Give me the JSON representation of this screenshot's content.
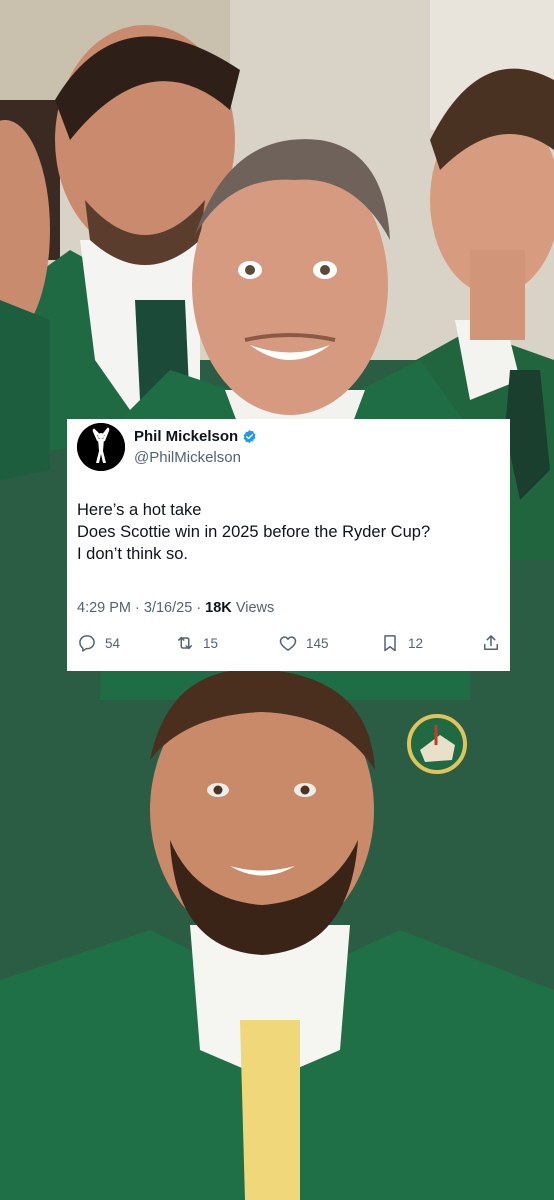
{
  "tweet": {
    "display_name": "Phil Mickelson",
    "handle": "@PhilMickelson",
    "verified": true,
    "avatar_icon": "golfer-silhouette-icon",
    "text_lines": [
      "Here’s a hot take",
      "Does Scottie win in 2025 before the Ryder Cup?",
      "I don’t think so."
    ],
    "time": "4:29 PM",
    "date": "3/16/25",
    "views_count": "18K",
    "views_label": "Views",
    "separator": "·",
    "actions": {
      "replies": {
        "icon": "reply-icon",
        "count": "54"
      },
      "reposts": {
        "icon": "repost-icon",
        "count": "15"
      },
      "likes": {
        "icon": "heart-icon",
        "count": "145"
      },
      "bookmarks": {
        "icon": "bookmark-icon",
        "count": "12"
      },
      "share": {
        "icon": "share-icon"
      }
    }
  },
  "colors": {
    "jacket_green": "#1e6b45",
    "verified_blue": "#1d9bf0",
    "text_primary": "#0f1419",
    "text_secondary": "#536471"
  }
}
